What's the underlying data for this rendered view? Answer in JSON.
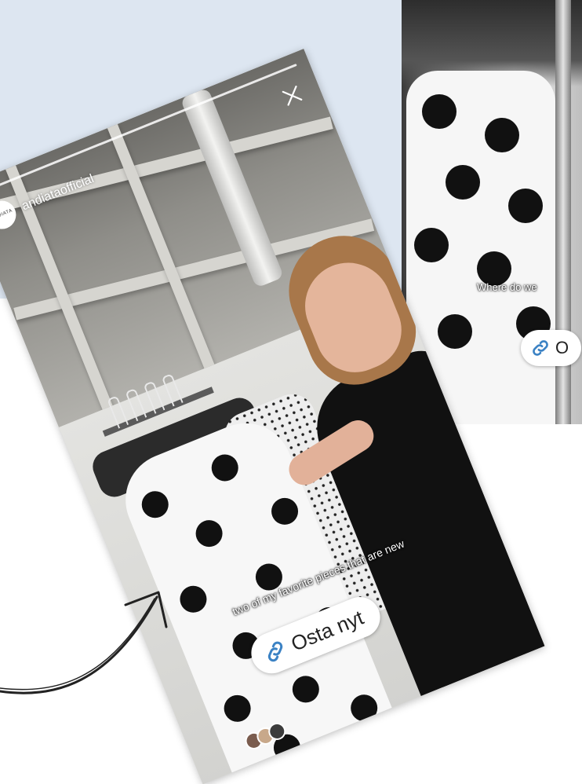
{
  "story_front": {
    "username": "andiataofficial",
    "avatar_text": "ANDIATA",
    "caption": "two of my favorite pieces that are new",
    "link_sticker_label": "Osta nyt"
  },
  "story_back": {
    "caption": "Where do we",
    "link_sticker_label": "O"
  },
  "colors": {
    "background_panel": "#dde6f1",
    "sticker_link_icon": "#3b82c4"
  },
  "icons": [
    "close-icon",
    "link-icon",
    "arrow-icon"
  ]
}
